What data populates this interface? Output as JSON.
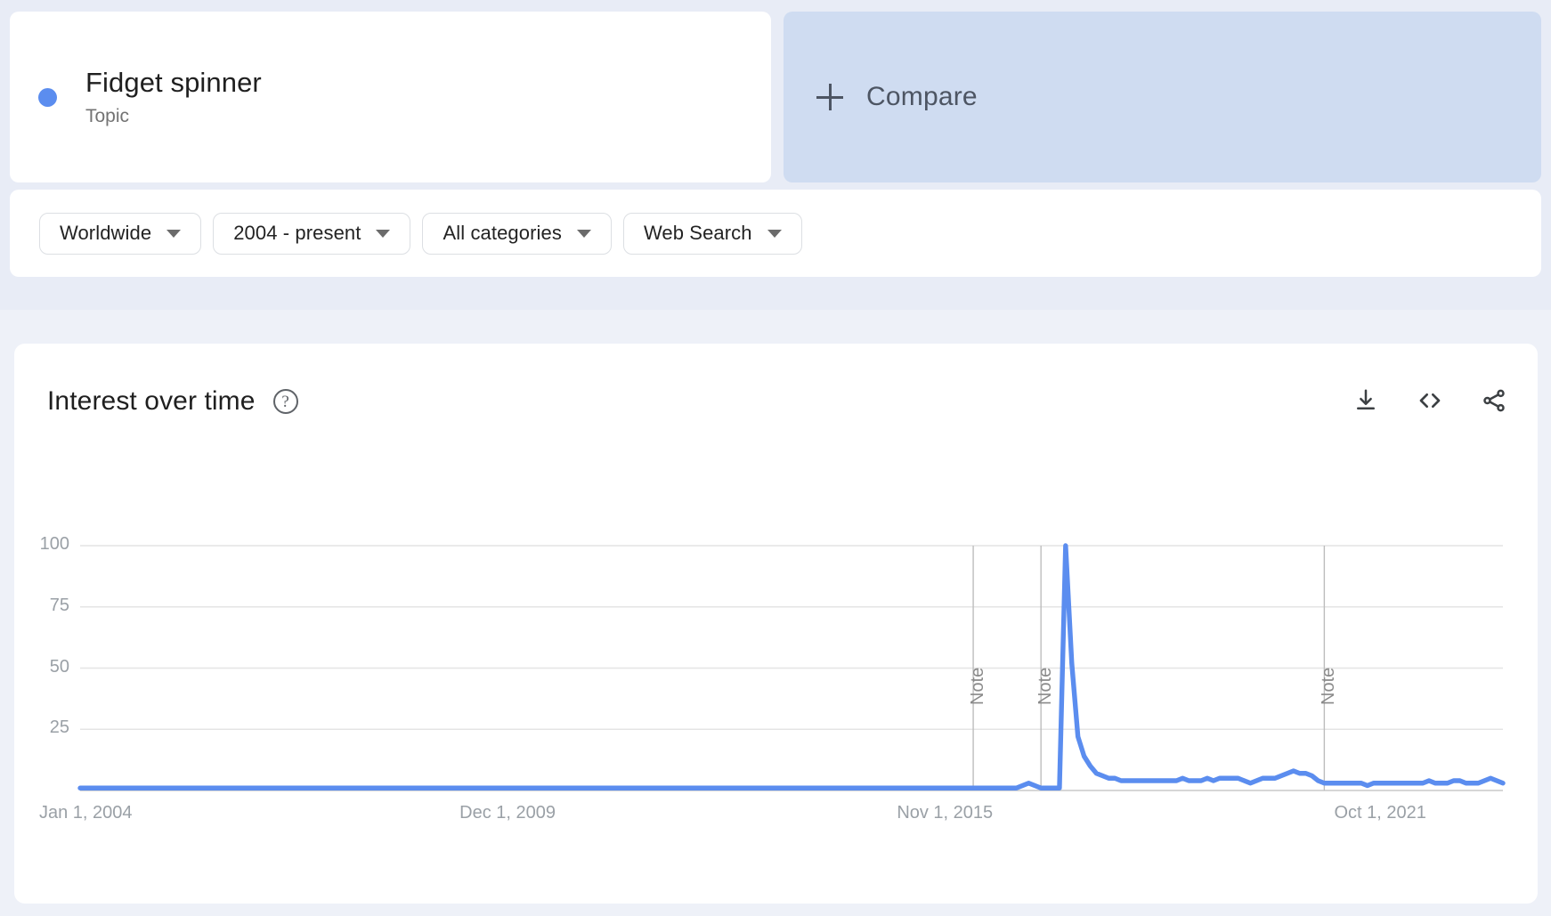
{
  "query": {
    "term_label": "Fidget spinner",
    "term_type": "Topic",
    "term_color": "#5b8def",
    "compare_label": "Compare"
  },
  "filters": {
    "location": "Worldwide",
    "time_range": "2004 - present",
    "category": "All categories",
    "search_type": "Web Search"
  },
  "chart_panel": {
    "title": "Interest over time",
    "help_icon": "help-icon",
    "download_icon": "download-icon",
    "embed_icon": "embed-code-icon",
    "share_icon": "share-icon"
  },
  "chart_data": {
    "type": "line",
    "title": "Interest over time",
    "xlabel": "",
    "ylabel": "",
    "ylim": [
      0,
      100
    ],
    "grid": true,
    "legend_position": "none",
    "series": [
      {
        "name": "Fidget spinner",
        "color": "#5b8def",
        "values": [
          1,
          1,
          1,
          1,
          1,
          1,
          1,
          1,
          1,
          1,
          1,
          1,
          1,
          1,
          1,
          1,
          1,
          1,
          1,
          1,
          1,
          1,
          1,
          1,
          1,
          1,
          1,
          1,
          1,
          1,
          1,
          1,
          1,
          1,
          1,
          1,
          1,
          1,
          1,
          1,
          1,
          1,
          1,
          1,
          1,
          1,
          1,
          1,
          1,
          1,
          1,
          1,
          1,
          1,
          1,
          1,
          1,
          1,
          1,
          1,
          1,
          1,
          1,
          1,
          1,
          1,
          1,
          1,
          1,
          1,
          1,
          1,
          1,
          1,
          1,
          1,
          1,
          1,
          1,
          1,
          1,
          1,
          1,
          1,
          1,
          1,
          1,
          1,
          1,
          1,
          1,
          1,
          1,
          1,
          1,
          1,
          1,
          1,
          1,
          1,
          1,
          1,
          1,
          1,
          1,
          1,
          1,
          1,
          1,
          1,
          1,
          1,
          1,
          1,
          1,
          1,
          1,
          1,
          1,
          1,
          1,
          1,
          1,
          1,
          1,
          1,
          1,
          1,
          1,
          1,
          1,
          1,
          1,
          1,
          1,
          1,
          1,
          1,
          1,
          1,
          1,
          1,
          1,
          1,
          1,
          1,
          1,
          1,
          1,
          1,
          1,
          1,
          1,
          2,
          3,
          2,
          1,
          1,
          1,
          1,
          100,
          52,
          22,
          14,
          10,
          7,
          6,
          5,
          5,
          4,
          4,
          4,
          4,
          4,
          4,
          4,
          4,
          4,
          4,
          5,
          4,
          4,
          4,
          5,
          4,
          5,
          5,
          5,
          5,
          4,
          3,
          4,
          5,
          5,
          5,
          6,
          7,
          8,
          7,
          7,
          6,
          4,
          3,
          3,
          3,
          3,
          3,
          3,
          3,
          2,
          3,
          3,
          3,
          3,
          3,
          3,
          3,
          3,
          3,
          4,
          3,
          3,
          3,
          4,
          4,
          3,
          3,
          3,
          4,
          5,
          4,
          3
        ]
      }
    ],
    "y_ticks": [
      100,
      75,
      50,
      25
    ],
    "x_ticks": [
      {
        "label": "Jan 1, 2004",
        "index": 0
      },
      {
        "label": "Dec 1, 2009",
        "index": 71
      },
      {
        "label": "Nov 1, 2015",
        "index": 142
      },
      {
        "label": "Oct 1, 2021",
        "index": 213
      }
    ],
    "annotations": [
      {
        "label": "Note",
        "index": 145
      },
      {
        "label": "Note",
        "index": 156
      },
      {
        "label": "Note",
        "index": 202
      }
    ],
    "peak_value": 100
  }
}
